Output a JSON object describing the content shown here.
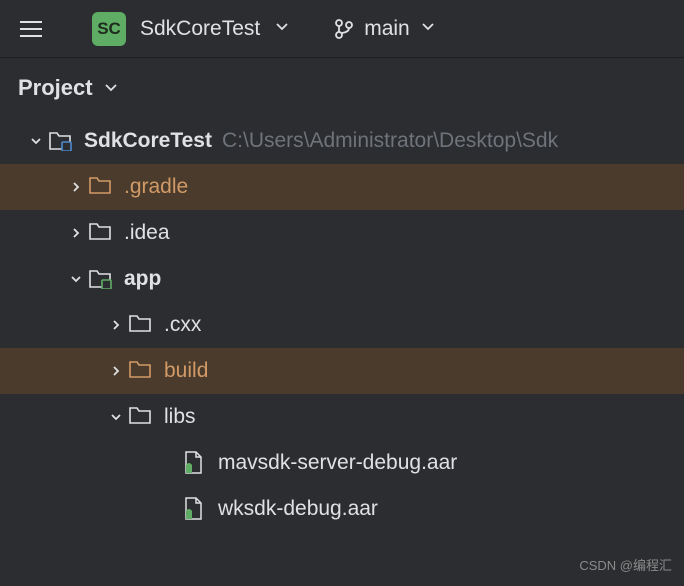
{
  "toolbar": {
    "project_badge": "SC",
    "project_name": "SdkCoreTest",
    "branch_name": "main"
  },
  "panel": {
    "title": "Project"
  },
  "tree": {
    "root": {
      "name": "SdkCoreTest",
      "path": "C:\\Users\\Administrator\\Desktop\\Sdk"
    },
    "gradle": ".gradle",
    "idea": ".idea",
    "app": "app",
    "cxx": ".cxx",
    "build": "build",
    "libs": "libs",
    "file1": "mavsdk-server-debug.aar",
    "file2": "wksdk-debug.aar"
  },
  "watermark": "CSDN @编程汇"
}
